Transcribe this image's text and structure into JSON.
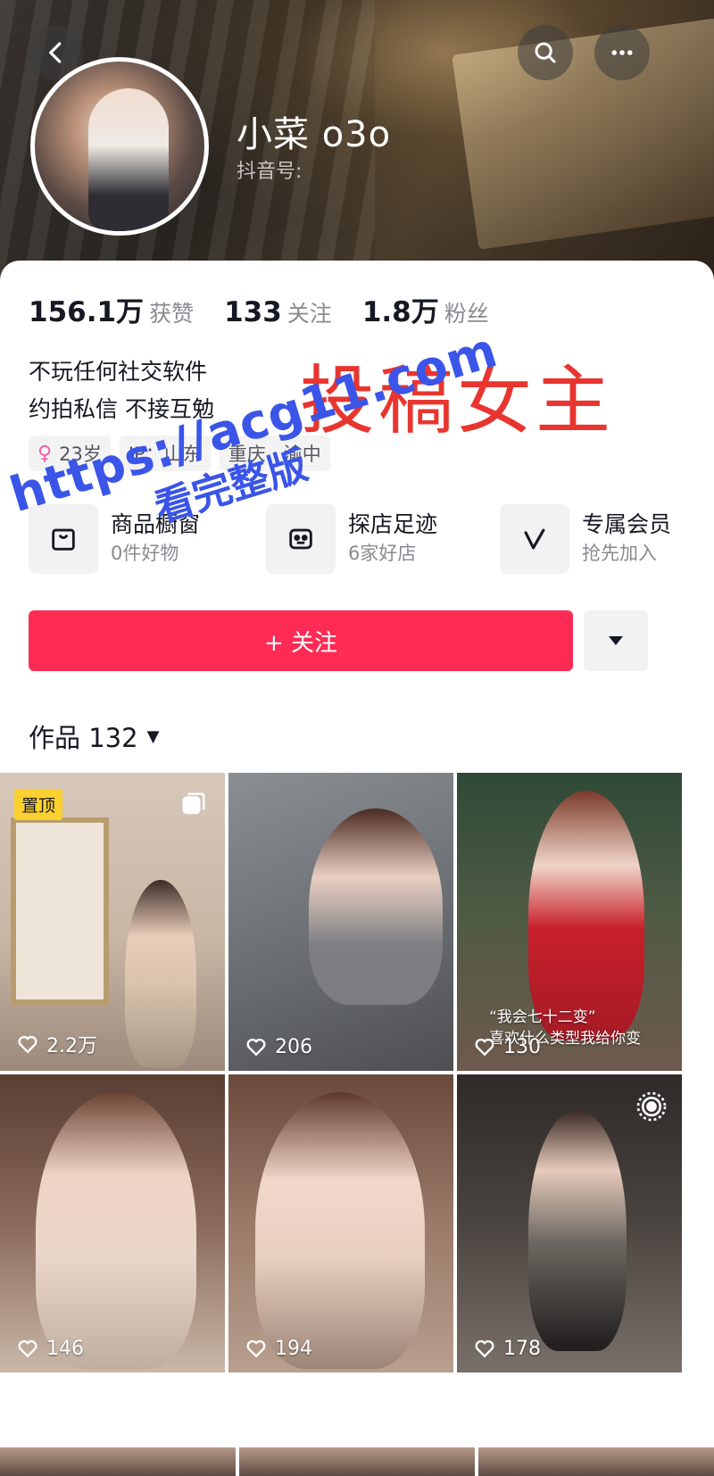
{
  "header": {
    "username": "小菜 o3o",
    "douyin_id_label": "抖音号:",
    "icons": [
      "back-icon",
      "search-icon",
      "more-icon"
    ]
  },
  "stats": [
    {
      "value": "156.1万",
      "label": "获赞"
    },
    {
      "value": "133",
      "label": "关注"
    },
    {
      "value": "1.8万",
      "label": "粉丝"
    }
  ],
  "bio": {
    "line1": "不玩任何社交软件",
    "line2": "约拍私信 不接互勉"
  },
  "overlay_text": "投稿女主",
  "tags": {
    "age": "23岁",
    "ip": "IP：山东",
    "location": "重庆 · 渝中"
  },
  "services": [
    {
      "title": "商品橱窗",
      "subtitle": "0件好物",
      "icon": "bag-icon"
    },
    {
      "title": "探店足迹",
      "subtitle": "6家好店",
      "icon": "shop-icon"
    },
    {
      "title": "专属会员",
      "subtitle": "抢先加入",
      "icon": "vip-icon"
    }
  ],
  "watermark": {
    "line1": "https://acg11.com",
    "line2": "看完整版"
  },
  "actions": {
    "follow_label": "+ 关注"
  },
  "works": {
    "tab_label": "作品 132"
  },
  "videos": [
    {
      "likes": "2.2万",
      "pinned": "置顶"
    },
    {
      "likes": "206"
    },
    {
      "likes": "130",
      "caption1": "“我会七十二变”",
      "caption2": "喜欢什么类型我给你变"
    },
    {
      "likes": "146"
    },
    {
      "likes": "194"
    },
    {
      "likes": "178"
    }
  ],
  "colors": {
    "follow_button": "#fe2c55",
    "overlay_red": "#e8352f",
    "watermark_blue": "#3a55e8",
    "pin_badge": "#fcd02f"
  }
}
